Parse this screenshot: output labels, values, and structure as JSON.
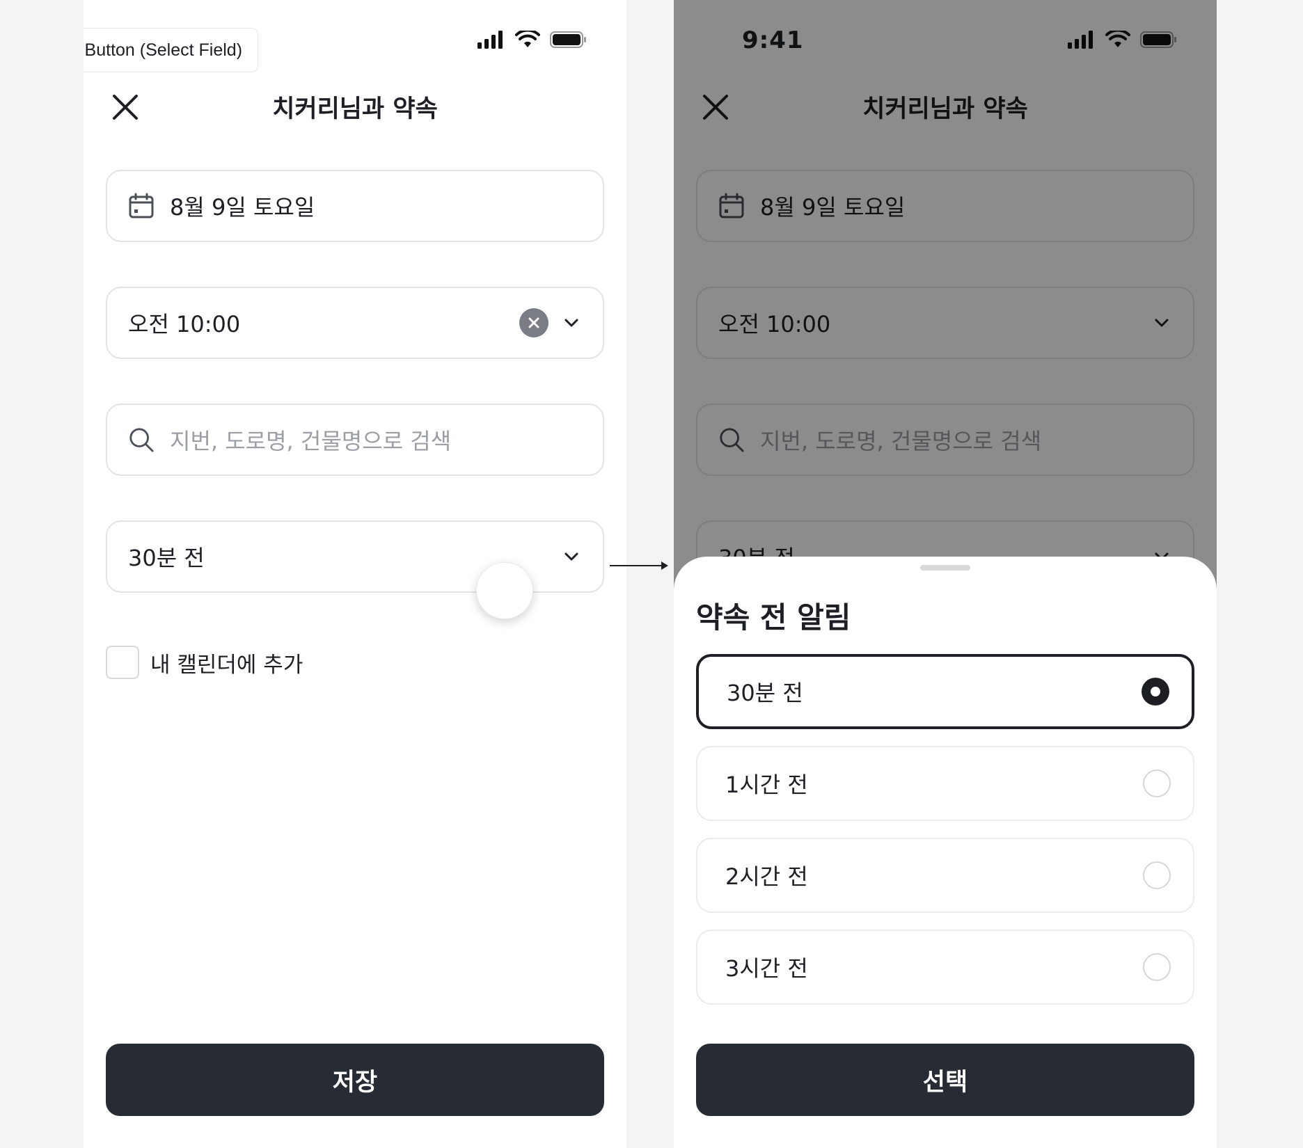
{
  "caption": "Input Button (Select Field)",
  "status": {
    "time": "9:41"
  },
  "form": {
    "title": "치커리님과 약속",
    "date_value": "8월 9일 토요일",
    "time_value": "오전 10:00",
    "search_placeholder": "지번, 도로명, 건물명으로 검색",
    "reminder_value": "30분 전",
    "calendar_checkbox_label": "내 캘린더에 추가",
    "save_label": "저장"
  },
  "sheet": {
    "title": "약속 전 알림",
    "options": [
      {
        "label": "30분 전",
        "selected": true
      },
      {
        "label": "1시간 전",
        "selected": false
      },
      {
        "label": "2시간 전",
        "selected": false
      },
      {
        "label": "3시간 전",
        "selected": false
      }
    ],
    "select_label": "선택"
  },
  "colors": {
    "primary_button": "#272c34",
    "overlay": "rgba(0,0,0,0.45)",
    "field_border": "#e3e4e8"
  }
}
